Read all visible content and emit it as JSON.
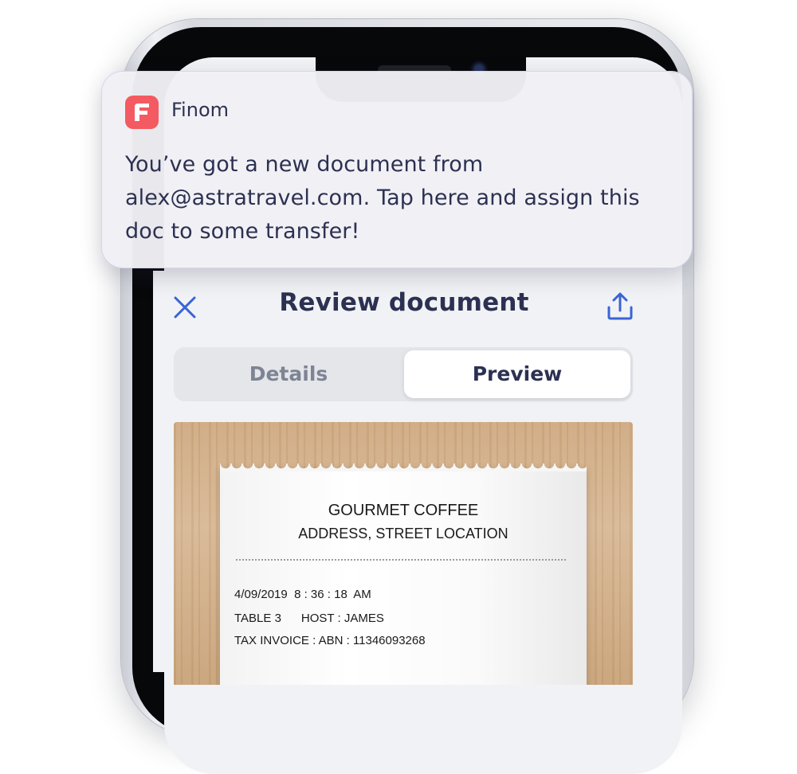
{
  "notification": {
    "app_name": "Finom",
    "message": "You’ve got a new document from alex@astratravel.com. Tap here and assign this doc to some transfer!",
    "icon": "finom-logo-icon",
    "icon_color": "#f45a61"
  },
  "header": {
    "title": "Review document",
    "close_icon": "close-icon",
    "share_icon": "share-icon",
    "accent_color": "#3a64d6"
  },
  "tabs": [
    {
      "label": "Details",
      "active": false
    },
    {
      "label": "Preview",
      "active": true
    }
  ],
  "receipt": {
    "merchant": "GOURMET COFFEE",
    "address": "ADDRESS, STREET LOCATION",
    "datetime": "4/09/2019  8 : 36 : 18  AM",
    "table_host": "TABLE 3      HOST : JAMES",
    "tax_invoice": "TAX INVOICE : ABN : 11346093268"
  }
}
